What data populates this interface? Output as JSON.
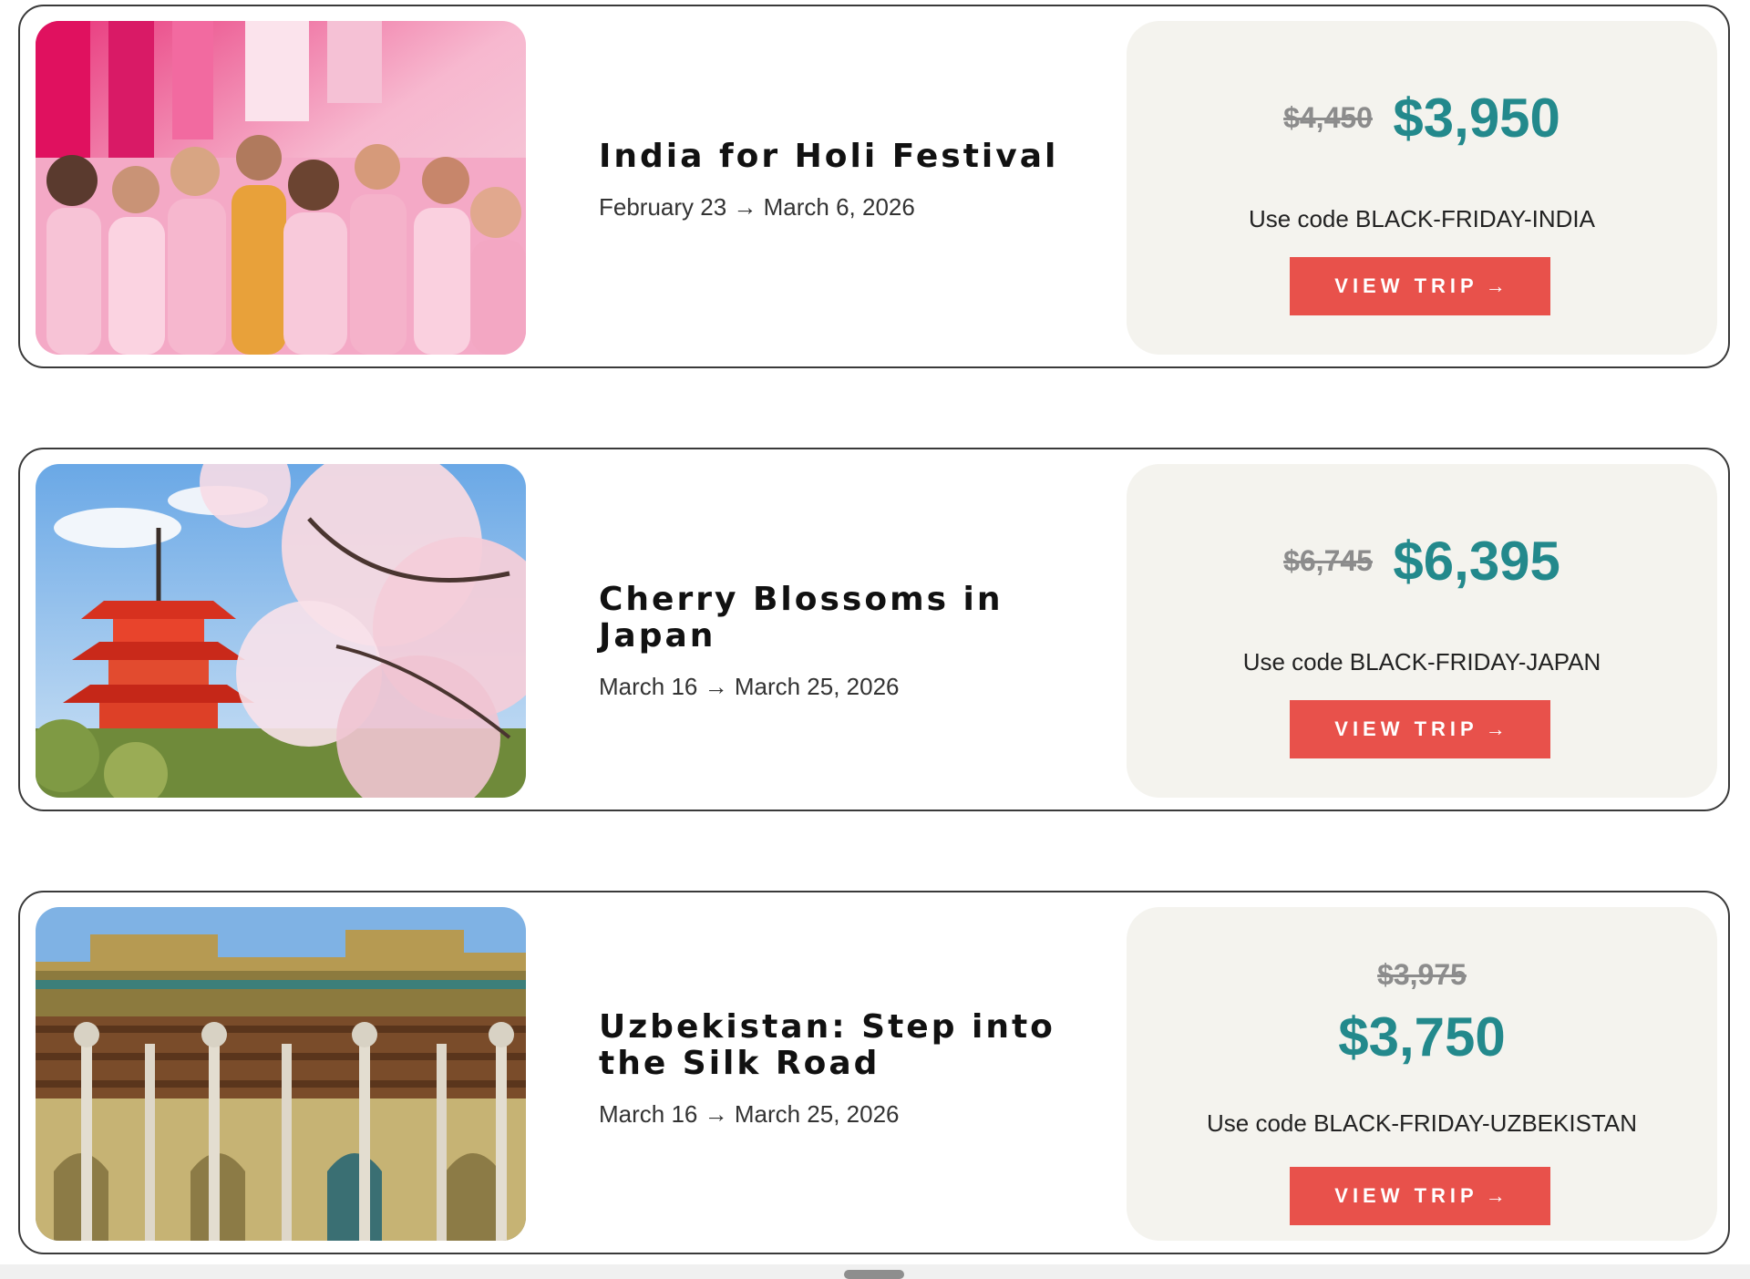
{
  "trips": [
    {
      "title": "India for Holi Festival",
      "dates": "February 23 → March 6, 2026",
      "old_price": "$4,450",
      "new_price": "$3,950",
      "promo": "Use code BLACK-FRIDAY-INDIA",
      "button_label": "VIEW TRIP",
      "button_icon": "arrow-right-icon",
      "photo_subject": "Group of travelers covered in pink Holi powder"
    },
    {
      "title": "Cherry Blossoms in Japan",
      "dates": "March 16 → March 25, 2026",
      "old_price": "$6,745",
      "new_price": "$6,395",
      "promo": "Use code BLACK-FRIDAY-JAPAN",
      "button_label": "VIEW TRIP",
      "button_icon": "arrow-right-icon",
      "photo_subject": "Red pagoda framed by pink cherry blossoms"
    },
    {
      "title": "Uzbekistan: Step into the Silk Road",
      "dates": "March 16 → March 25, 2026",
      "old_price": "$3,975",
      "new_price": "$3,750",
      "promo": "Use code BLACK-FRIDAY-UZBEKISTAN",
      "button_label": "VIEW TRIP",
      "button_icon": "arrow-right-icon",
      "photo_subject": "Ornate Silk Road mosque with carved wooden columns"
    }
  ],
  "colors": {
    "price_accent": "#23898c",
    "button_bg": "#e8514b",
    "panel_bg": "#f4f3ee",
    "old_price": "#8c8c8c"
  }
}
